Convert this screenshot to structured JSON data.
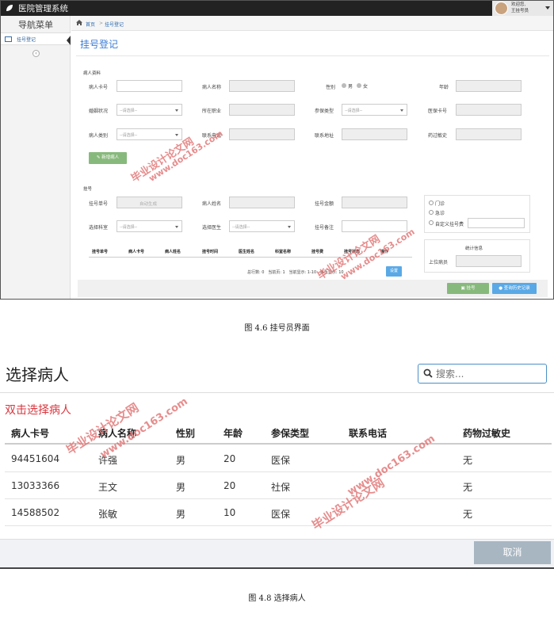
{
  "figure1": {
    "app_title": "医院管理系统",
    "user": {
      "welcome": "欢迎您,",
      "name": "王挂号员"
    },
    "sidebar": {
      "title": "导航菜单",
      "item": "挂号登记"
    },
    "breadcrumb": {
      "home": "首页",
      "separator": ">",
      "current": "挂号登记"
    },
    "page_title": "挂号登记",
    "patient_section": {
      "title": "病人资料",
      "labels": {
        "card_no": "病人卡号",
        "name": "病人名称",
        "gender": "性别",
        "age": "年龄",
        "marital": "婚姻状况",
        "occupation": "所在职业",
        "insurance_type": "参保类型",
        "insurance_card": "医保卡号",
        "patient_type": "病人类别",
        "phone": "联系电话",
        "address": "联系地址",
        "allergy": "药过敏史"
      },
      "gender_male": "男",
      "gender_female": "女",
      "select_placeholder": "--请选择--",
      "add_button": "新增病人"
    },
    "register_section": {
      "title": "挂号",
      "labels": {
        "reg_no": "挂号单号",
        "patient_name": "病人姓名",
        "amount": "挂号金额",
        "department": "选择科室",
        "doctor": "选择医生",
        "note": "挂号备注"
      },
      "reg_no_value": "自动生成",
      "select_placeholder": "--请选择--",
      "type_options": [
        "门诊",
        "急诊"
      ],
      "custom_fee": "自定义挂号费",
      "stats_title": "统计信息",
      "registrar": "上位病员",
      "table_headers": [
        "挂号单号",
        "病人卡号",
        "病人姓名",
        "挂号时间",
        "医生姓名",
        "科室名称",
        "挂号费",
        "挂号状态",
        "操作"
      ],
      "pager": {
        "total_label": "总行数:",
        "total": "0",
        "page_label": "当前页:",
        "page": "1",
        "shown_label": "当前显示:",
        "shown": "1-10",
        "per_page_label": "每页显示:",
        "per_page": "10",
        "go": "设置"
      }
    },
    "buttons": {
      "register": "挂号",
      "history": "查询历史记录"
    },
    "caption": "图 4.6  挂号员界面"
  },
  "figure2": {
    "title": "选择病人",
    "search_placeholder": "搜索...",
    "hint": "双击选择病人",
    "columns": [
      "病人卡号",
      "病人名称",
      "性别",
      "年龄",
      "参保类型",
      "联系电话",
      "药物过敏史"
    ],
    "rows": [
      [
        "94451604",
        "许强",
        "男",
        "20",
        "医保",
        "",
        "无"
      ],
      [
        "13033366",
        "王文",
        "男",
        "20",
        "社保",
        "",
        "无"
      ],
      [
        "14588502",
        "张敏",
        "男",
        "10",
        "医保",
        "",
        "无"
      ]
    ],
    "cancel": "取消",
    "caption": "图 4.8  选择病人"
  },
  "watermark": {
    "line1": "毕业设计论文网",
    "line2": "www.doc163.com",
    "color": "#e27a7a"
  }
}
